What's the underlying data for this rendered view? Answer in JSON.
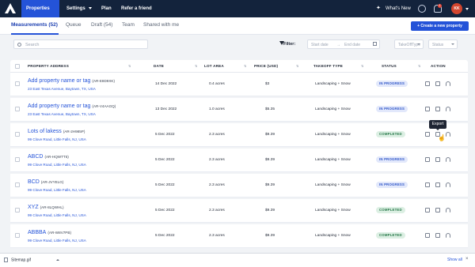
{
  "nav": {
    "items": [
      {
        "label": "Properties"
      },
      {
        "label": "Settings"
      },
      {
        "label": "Plan"
      },
      {
        "label": "Refer a friend"
      }
    ],
    "whats_new": "What's New",
    "notif_count": "1",
    "user_initials": "KK"
  },
  "tabs": [
    {
      "label": "Measurements (52)"
    },
    {
      "label": "Queue"
    },
    {
      "label": "Draft (54)"
    },
    {
      "label": "Team"
    },
    {
      "label": "Shared with me"
    }
  ],
  "create_button": "+ Create a new property",
  "search": {
    "placeholder": "Search"
  },
  "filters": {
    "label": "Filter:",
    "start_date": "Start date",
    "end_date": "End date",
    "takeoff_type": "TakeOffType",
    "status": "Status"
  },
  "columns": [
    "PROPERTY ADDRESS",
    "DATE",
    "LOT AREA",
    "PRICE (USD)",
    "TAKEOFF TYPE",
    "STATUS",
    "ACTION"
  ],
  "rows": [
    {
      "name": "Add property name or tag",
      "code": "(AR-E8D9XK)",
      "address": "23 East Texas Avenue, Baytown, TX, USA",
      "date": "14 Dec 2022",
      "area": "0.4 acres",
      "price": "$3",
      "takeoff": "Landscaping + Snow",
      "status": "IN PROGRESS"
    },
    {
      "name": "Add property name or tag",
      "code": "(AR-V4AAGQ)",
      "address": "23 East Texas Avenue, Baytown, TX, USA",
      "date": "13 Dec 2022",
      "area": "1.0 acres",
      "price": "$5.35",
      "takeoff": "Landscaping + Snow",
      "status": "IN PROGRESS"
    },
    {
      "name": "Lots of lakess",
      "code": "(AR-2H985P)",
      "address": "99 Clove Road, Little Falls, NJ, USA",
      "date": "5 Dec 2022",
      "area": "2.3 acres",
      "price": "$9.39",
      "takeoff": "Landscaping + Snow",
      "status": "COMPLETED"
    },
    {
      "name": "ABCD",
      "code": "(AR-HQWTT5)",
      "address": "99 Clove Road, Little Falls, NJ, USA",
      "date": "5 Dec 2022",
      "area": "2.3 acres",
      "price": "$9.39",
      "takeoff": "Landscaping + Snow",
      "status": "IN PROGRESS"
    },
    {
      "name": "BCD",
      "code": "(AR-JVYELG)",
      "address": "99 Clove Road, Little Falls, NJ, USA",
      "date": "5 Dec 2022",
      "area": "2.3 acres",
      "price": "$9.39",
      "takeoff": "Landscaping + Snow",
      "status": "IN PROGRESS"
    },
    {
      "name": "XYZ",
      "code": "(AR-8LQWHL)",
      "address": "99 Clove Road, Little Falls, NJ, USA",
      "date": "5 Dec 2022",
      "area": "2.3 acres",
      "price": "$9.39",
      "takeoff": "Landscaping + Snow",
      "status": "COMPLETED"
    },
    {
      "name": "ABBBA",
      "code": "(AR-W8V7PB)",
      "address": "99 Clove Road, Little Falls, NJ, USA",
      "date": "5 Dec 2022",
      "area": "2.3 acres",
      "price": "$9.39",
      "takeoff": "Landscaping + Snow",
      "status": "COMPLETED"
    }
  ],
  "tooltip": "Export",
  "download": {
    "filename": "Sitemap.gif",
    "show_all": "Show all",
    "close": "×"
  },
  "icons": {
    "logo": "logo-icon",
    "search": "search-icon",
    "filter": "filter-icon",
    "calendar": "calendar-icon",
    "help": "help-icon",
    "bell": "bell-icon",
    "copy": "duplicate-icon",
    "export": "export-icon",
    "support": "headset-icon"
  },
  "colors": {
    "accent": "#2453d8",
    "nav_bg": "#13233c",
    "completed": "#2a7a4b",
    "in_progress": "#2f56c8"
  }
}
